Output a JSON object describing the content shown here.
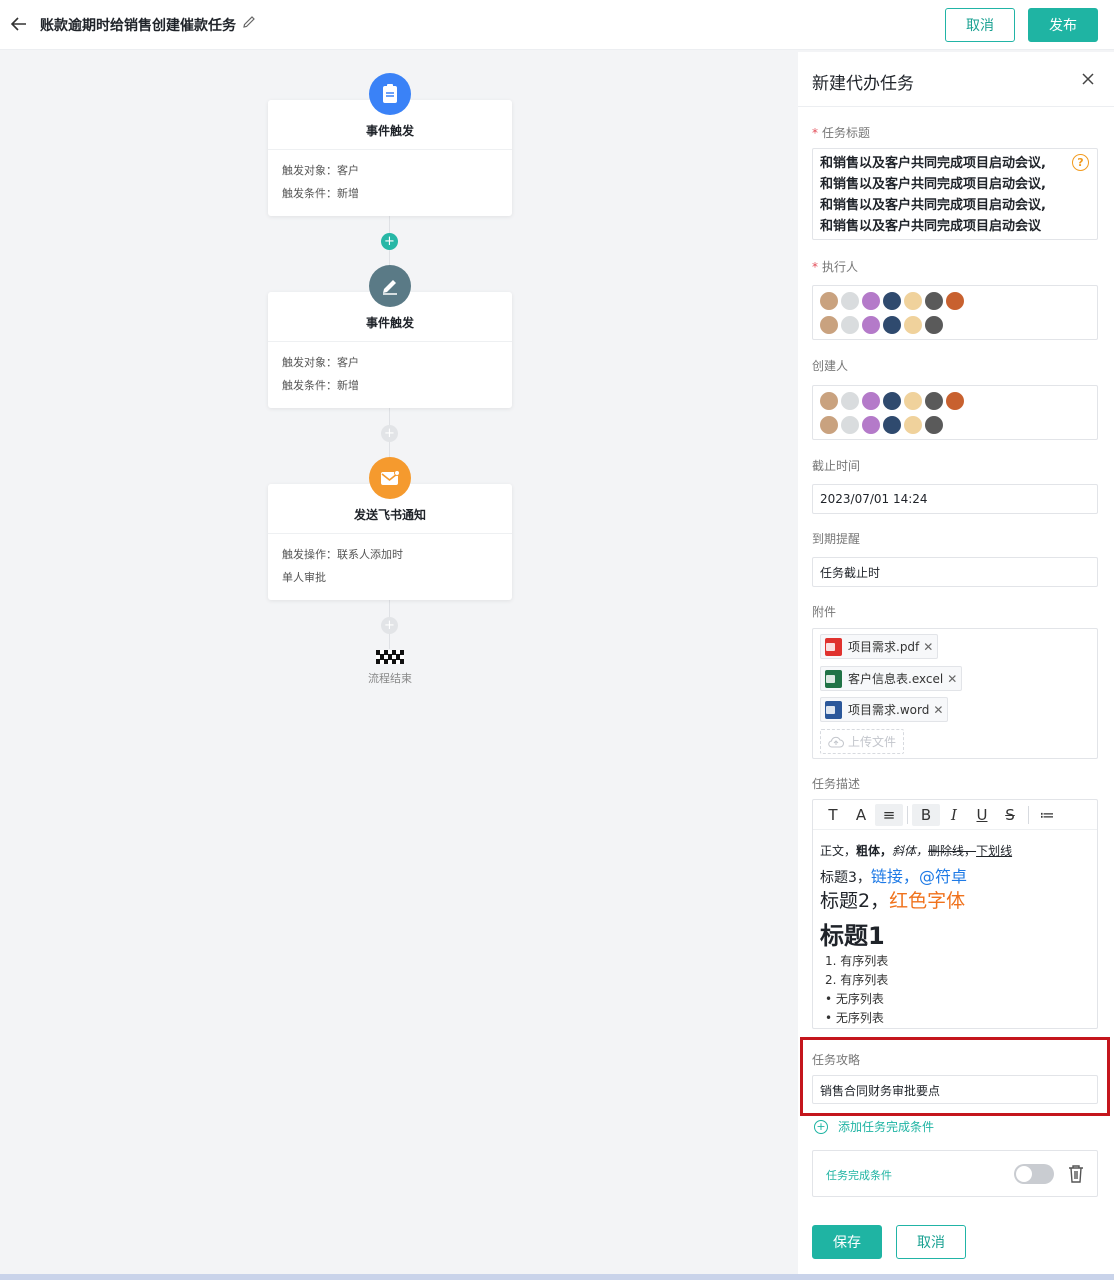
{
  "header": {
    "title": "账款逾期时给销售创建催款任务",
    "cancel_label": "取消",
    "publish_label": "发布"
  },
  "flow": {
    "nodes": [
      {
        "title": "事件触发",
        "lines": [
          "触发对象：客户",
          "触发条件：新增"
        ],
        "icon": "clipboard-icon",
        "color": "#3a82f7"
      },
      {
        "title": "事件触发",
        "lines": [
          "触发对象：客户",
          "触发条件：新增"
        ],
        "icon": "edit-icon",
        "color": "#5a7a86"
      },
      {
        "title": "发送飞书通知",
        "lines": [
          "触发操作：联系人添加时",
          "单人审批"
        ],
        "icon": "mail-icon",
        "color": "#f59a2e"
      }
    ],
    "end_label": "流程结束"
  },
  "panel": {
    "title": "新建代办任务",
    "task_title": {
      "label": "任务标题",
      "lines": [
        "和销售以及客户共同完成项目启动会议,",
        "和销售以及客户共同完成项目启动会议,",
        "和销售以及客户共同完成项目启动会议,",
        "和销售以及客户共同完成项目启动会议"
      ]
    },
    "executor": {
      "label": "执行人"
    },
    "creator": {
      "label": "创建人"
    },
    "deadline": {
      "label": "截止时间",
      "value": "2023/07/01 14:24"
    },
    "reminder": {
      "label": "到期提醒",
      "value": "任务截止时"
    },
    "attachments": {
      "label": "附件",
      "files": [
        {
          "name": "项目需求.pdf",
          "icon": "pdf-file-icon",
          "color": "#e0322e"
        },
        {
          "name": "客户信息表.excel",
          "icon": "excel-file-icon",
          "color": "#217346"
        },
        {
          "name": "项目需求.word",
          "icon": "word-file-icon",
          "color": "#2b579a"
        }
      ],
      "upload_label": "上传文件"
    },
    "description": {
      "label": "任务描述",
      "toolbar": [
        "T",
        "A",
        "≡",
        "B",
        "I",
        "U",
        "S",
        "≔"
      ],
      "line1": {
        "a": "正文，",
        "b": "粗体，",
        "c": "斜体，",
        "d": "删除线，",
        "e": "下划线"
      },
      "line2": {
        "a": "标题3，",
        "b": "链接，",
        "c": "@符卓"
      },
      "line3": {
        "a": "标题2，",
        "b": "红色字体"
      },
      "line4": "标题1",
      "ordered": [
        {
          "n": "1.",
          "t": "有序列表"
        },
        {
          "n": "2.",
          "t": "有序列表"
        }
      ],
      "bullets": [
        {
          "n": "•",
          "t": "无序列表"
        },
        {
          "n": "•",
          "t": "无序列表"
        }
      ]
    },
    "strategy": {
      "label": "任务攻略",
      "value": "销售合同财务审批要点"
    },
    "add_condition_label": "添加任务完成条件",
    "condition_label": "任务完成条件",
    "condition_enabled": false,
    "save_label": "保存",
    "cancel_label": "取消"
  },
  "colors": {
    "accent": "#1fb4a3",
    "highlight": "#c4161c",
    "link": "#1e7ae6",
    "red_text": "#f0721c"
  }
}
